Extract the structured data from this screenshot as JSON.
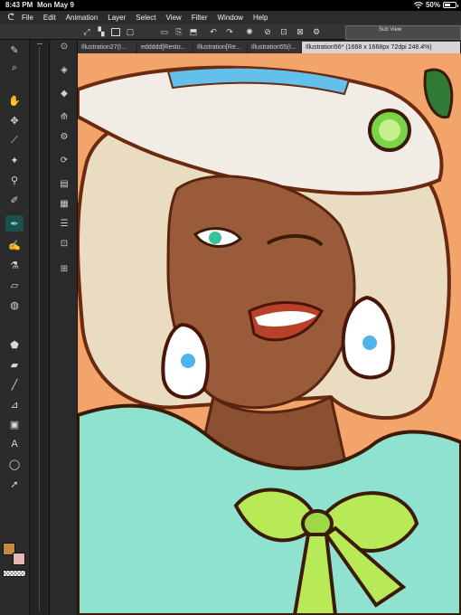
{
  "status": {
    "time": "8:43 PM",
    "date": "Mon May 9",
    "battery": "50%",
    "battery_level": 0.5,
    "icons": [
      "wifi-icon",
      "battery-icon"
    ]
  },
  "menu": {
    "logo_icon": "clip-studio-logo-icon",
    "items": [
      "File",
      "Edit",
      "Animation",
      "Layer",
      "Select",
      "View",
      "Filter",
      "Window",
      "Help"
    ]
  },
  "commandbar": {
    "icons": [
      "transform-icon",
      "select-icon",
      "new-file-icon",
      "open-icon",
      "save-icon",
      "export-icon",
      "undo-icon",
      "redo-icon",
      "loading-icon",
      "clear-icon",
      "crop-icon",
      "fill-icon",
      "settings-icon"
    ],
    "subview_title": "Sub View"
  },
  "tabs": [
    {
      "label": "Illustration27(I...",
      "active": false
    },
    {
      "label": "eddddd[Resto...",
      "active": false
    },
    {
      "label": "Illustration[Re...",
      "active": false
    },
    {
      "label": "Illustration55(I...",
      "active": false
    },
    {
      "label": "Illustration56* (1668 x 1668px 72dpi 248.4%)",
      "active": true
    }
  ],
  "tools": [
    {
      "name": "pen-icon",
      "glyph": "✎"
    },
    {
      "name": "zoom-icon",
      "glyph": "⌕"
    },
    {
      "name": "hand-icon",
      "glyph": "✋"
    },
    {
      "name": "move-icon",
      "glyph": "✥"
    },
    {
      "name": "eyedropper-icon",
      "glyph": "⟋"
    },
    {
      "name": "magic-wand-icon",
      "glyph": "✦"
    },
    {
      "name": "pipette-icon",
      "glyph": "⚲"
    },
    {
      "name": "pencil-icon",
      "glyph": "✐"
    },
    {
      "name": "brush-pen-icon",
      "glyph": "✒",
      "active": true
    },
    {
      "name": "brush-icon",
      "glyph": "✍"
    },
    {
      "name": "airbrush-icon",
      "glyph": "⚗"
    },
    {
      "name": "eraser-icon",
      "glyph": "▱"
    },
    {
      "name": "blend-icon",
      "glyph": "◍"
    },
    {
      "name": "fill-icon",
      "glyph": "⬟"
    },
    {
      "name": "gradient-icon",
      "glyph": "▰"
    },
    {
      "name": "shape-icon",
      "glyph": "╱"
    },
    {
      "name": "ruler-icon",
      "glyph": "⊿"
    },
    {
      "name": "frame-icon",
      "glyph": "▣"
    },
    {
      "name": "text-icon",
      "glyph": "A"
    },
    {
      "name": "balloon-icon",
      "glyph": "◯"
    },
    {
      "name": "correct-line-icon",
      "glyph": "➚"
    }
  ],
  "colors": {
    "main": "#c58a42",
    "sub": "#e3b7b3",
    "accent": "#6ee6c4"
  },
  "tool_props": [
    {
      "name": "search-icon",
      "glyph": "⊙"
    },
    {
      "name": "layer-stack-icon",
      "glyph": "◈"
    },
    {
      "name": "layers-icon",
      "glyph": "◆"
    },
    {
      "name": "material-icon",
      "glyph": "⟰"
    },
    {
      "name": "auto-action-icon",
      "glyph": "⚙"
    },
    {
      "name": "brush-size-icon",
      "glyph": "⟳"
    },
    {
      "name": "navigator-icon",
      "glyph": "▤"
    },
    {
      "name": "layer-property-icon",
      "glyph": "▦"
    },
    {
      "name": "history-icon",
      "glyph": "☰"
    },
    {
      "name": "layer-search-icon",
      "glyph": "⊡"
    },
    {
      "name": "sub-tool-detail-icon",
      "glyph": "⊞"
    }
  ],
  "canvas": {
    "background": "#f2a46b",
    "description_icon": "illustration-artwork"
  }
}
